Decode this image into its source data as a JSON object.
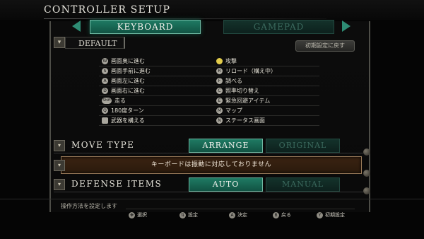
{
  "header": {
    "title": "CONTROLLER SETUP"
  },
  "tabs": [
    {
      "label": "KEYBOARD",
      "active": true
    },
    {
      "label": "GAMEPAD",
      "active": false
    }
  ],
  "preset": {
    "label": "DEFAULT",
    "reset_label": "初期設定に戻す"
  },
  "keys": {
    "left": [
      {
        "key": "W",
        "action": "画面奥に進む"
      },
      {
        "key": "S",
        "action": "画面手前に進む"
      },
      {
        "key": "A",
        "action": "画面左に進む"
      },
      {
        "key": "D",
        "action": "画面右に進む"
      },
      {
        "key": "Shift",
        "action": "走る"
      },
      {
        "key": "Q",
        "action": "180度ターン"
      },
      {
        "key": "⌖",
        "action": "武器を構える"
      }
    ],
    "right": [
      {
        "key": "●",
        "action": "攻撃"
      },
      {
        "key": "R",
        "action": "リロード（構え中）"
      },
      {
        "key": "F",
        "action": "調べる"
      },
      {
        "key": "C",
        "action": "照準切り替え"
      },
      {
        "key": "E",
        "action": "緊急回避アイテム"
      },
      {
        "key": "M",
        "action": "マップ"
      },
      {
        "key": "N",
        "action": "ステータス画面"
      }
    ]
  },
  "move_type": {
    "label": "MOVE TYPE",
    "options": [
      "ARRANGE",
      "ORIGINAL"
    ],
    "selected": "ARRANGE"
  },
  "notice": "キーボードは振動に対応しておりません",
  "defense_items": {
    "label": "DEFENSE ITEMS",
    "options": [
      "AUTO",
      "MANUAL"
    ],
    "selected": "AUTO"
  },
  "help_text": "操作方法を設定します",
  "hints": [
    {
      "key": "✥",
      "label": "選択"
    },
    {
      "key": "⇅",
      "label": "設定"
    },
    {
      "key": "A",
      "label": "決定"
    },
    {
      "key": "B",
      "label": "戻る"
    },
    {
      "key": "Y",
      "label": "初期設定"
    }
  ],
  "colors": {
    "accent": "#1f7a63",
    "accent_dim": "#14322b",
    "notice_bg": "#3a2312"
  }
}
